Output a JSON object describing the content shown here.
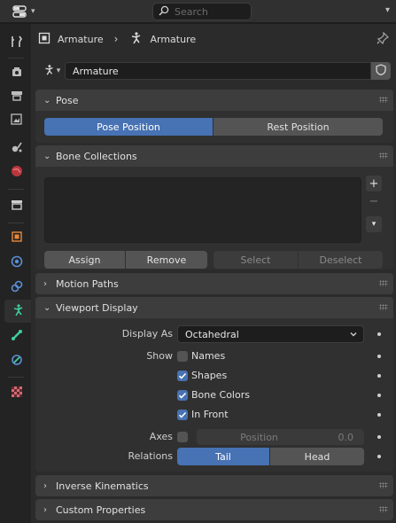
{
  "header": {
    "search_placeholder": "Search"
  },
  "context": {
    "object_name": "Armature",
    "data_name": "Armature"
  },
  "datablock": {
    "name": "Armature"
  },
  "panels": {
    "pose": {
      "title": "Pose",
      "pose_position_label": "Pose Position",
      "rest_position_label": "Rest Position",
      "active": "Pose Position"
    },
    "bone_collections": {
      "title": "Bone Collections",
      "assign_label": "Assign",
      "remove_label": "Remove",
      "select_label": "Select",
      "deselect_label": "Deselect"
    },
    "motion_paths": {
      "title": "Motion Paths"
    },
    "viewport_display": {
      "title": "Viewport Display",
      "display_as_label": "Display As",
      "display_as_value": "Octahedral",
      "show_label": "Show",
      "names_label": "Names",
      "names_checked": false,
      "shapes_label": "Shapes",
      "shapes_checked": true,
      "bone_colors_label": "Bone Colors",
      "bone_colors_checked": true,
      "in_front_label": "In Front",
      "in_front_checked": true,
      "axes_label": "Axes",
      "axes_checked": false,
      "axes_position_label": "Position",
      "axes_position_value": "0.0",
      "relations_label": "Relations",
      "tail_label": "Tail",
      "head_label": "Head",
      "relations_active": "Tail"
    },
    "inverse_kinematics": {
      "title": "Inverse Kinematics"
    },
    "custom_properties": {
      "title": "Custom Properties"
    }
  },
  "sidebar_tabs": [
    "tool",
    "render",
    "output",
    "view-layer",
    "scene",
    "world",
    "collection",
    "object",
    "modifiers",
    "physics",
    "object-constraints",
    "object-data-armature",
    "bone",
    "bone-constraints",
    "texture"
  ],
  "colors": {
    "accent": "#4772b3",
    "panel_header": "#3d3d3d",
    "panel_body": "#303030",
    "background": "#1d1d1d",
    "object_orange": "#e8893a",
    "armature_green": "#3fcf9c",
    "bone_green": "#3fcf9c",
    "constraint_blue": "#5a8fd6"
  }
}
